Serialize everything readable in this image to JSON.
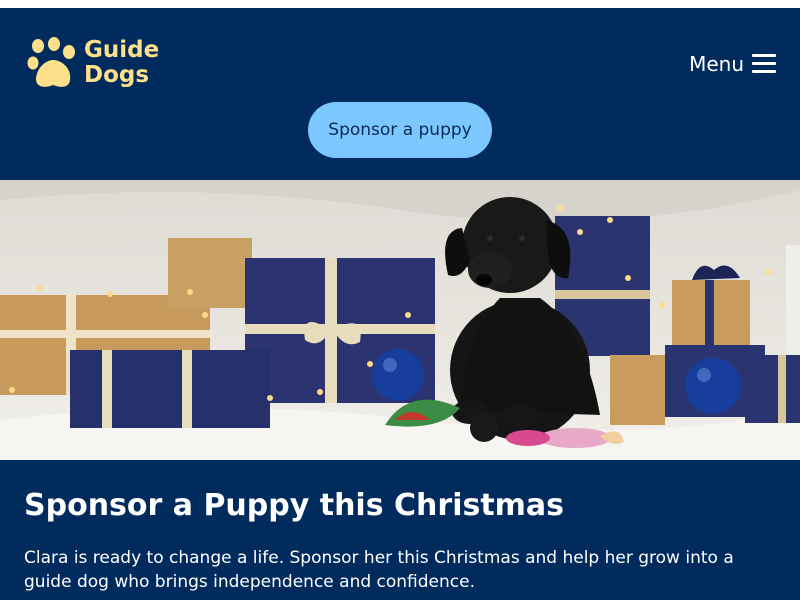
{
  "header": {
    "logo_line1": "Guide",
    "logo_line2": "Dogs",
    "logo_icon": "paw-icon",
    "menu_label": "Menu",
    "menu_icon": "hamburger-icon",
    "cta_label": "Sponsor a puppy"
  },
  "hero": {
    "image_alt": "Black Labrador puppy sitting among wrapped Christmas presents"
  },
  "main": {
    "title": "Sponsor a Puppy this Christmas",
    "intro": "Clara is ready to change a life. Sponsor her this Christmas and help her grow into a guide dog who brings independence and confidence."
  },
  "colors": {
    "brand_navy": "#002b5c",
    "logo_yellow": "#ffe08a",
    "cta_blue": "#7cc7ff"
  }
}
